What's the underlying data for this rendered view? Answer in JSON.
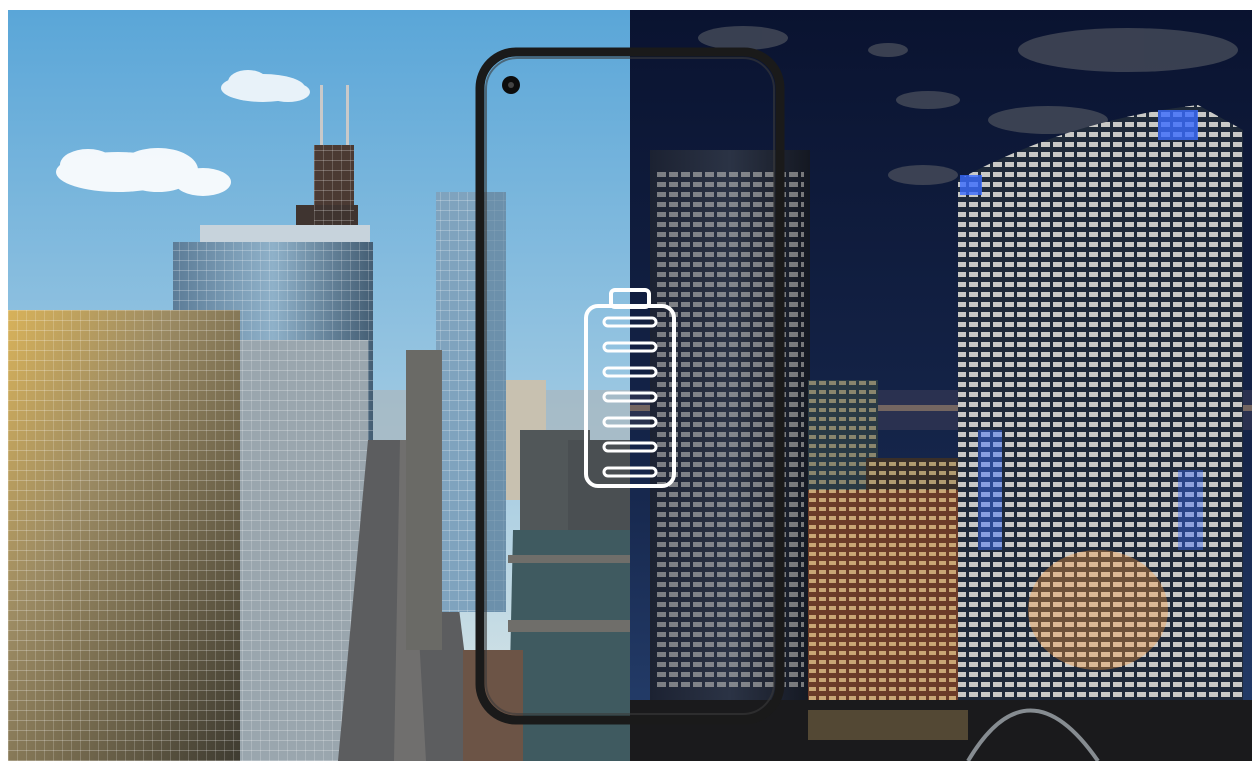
{
  "scene": {
    "left_half": "day",
    "right_half": "night"
  },
  "colors": {
    "sky_day_top": "#5aa6d8",
    "sky_day_bottom": "#cfe2ea",
    "sky_night_top": "#0a1330",
    "sky_night_bottom": "#233a66",
    "phone_frame": "#1a1a1a",
    "battery_icon": "#ffffff",
    "city_lights": "#ffd27a",
    "night_blue_lights": "#3a6cff"
  },
  "icons": {
    "battery": "battery-full-icon",
    "camera": "front-camera-icon"
  },
  "battery": {
    "level": 1.0,
    "bars": 7
  }
}
